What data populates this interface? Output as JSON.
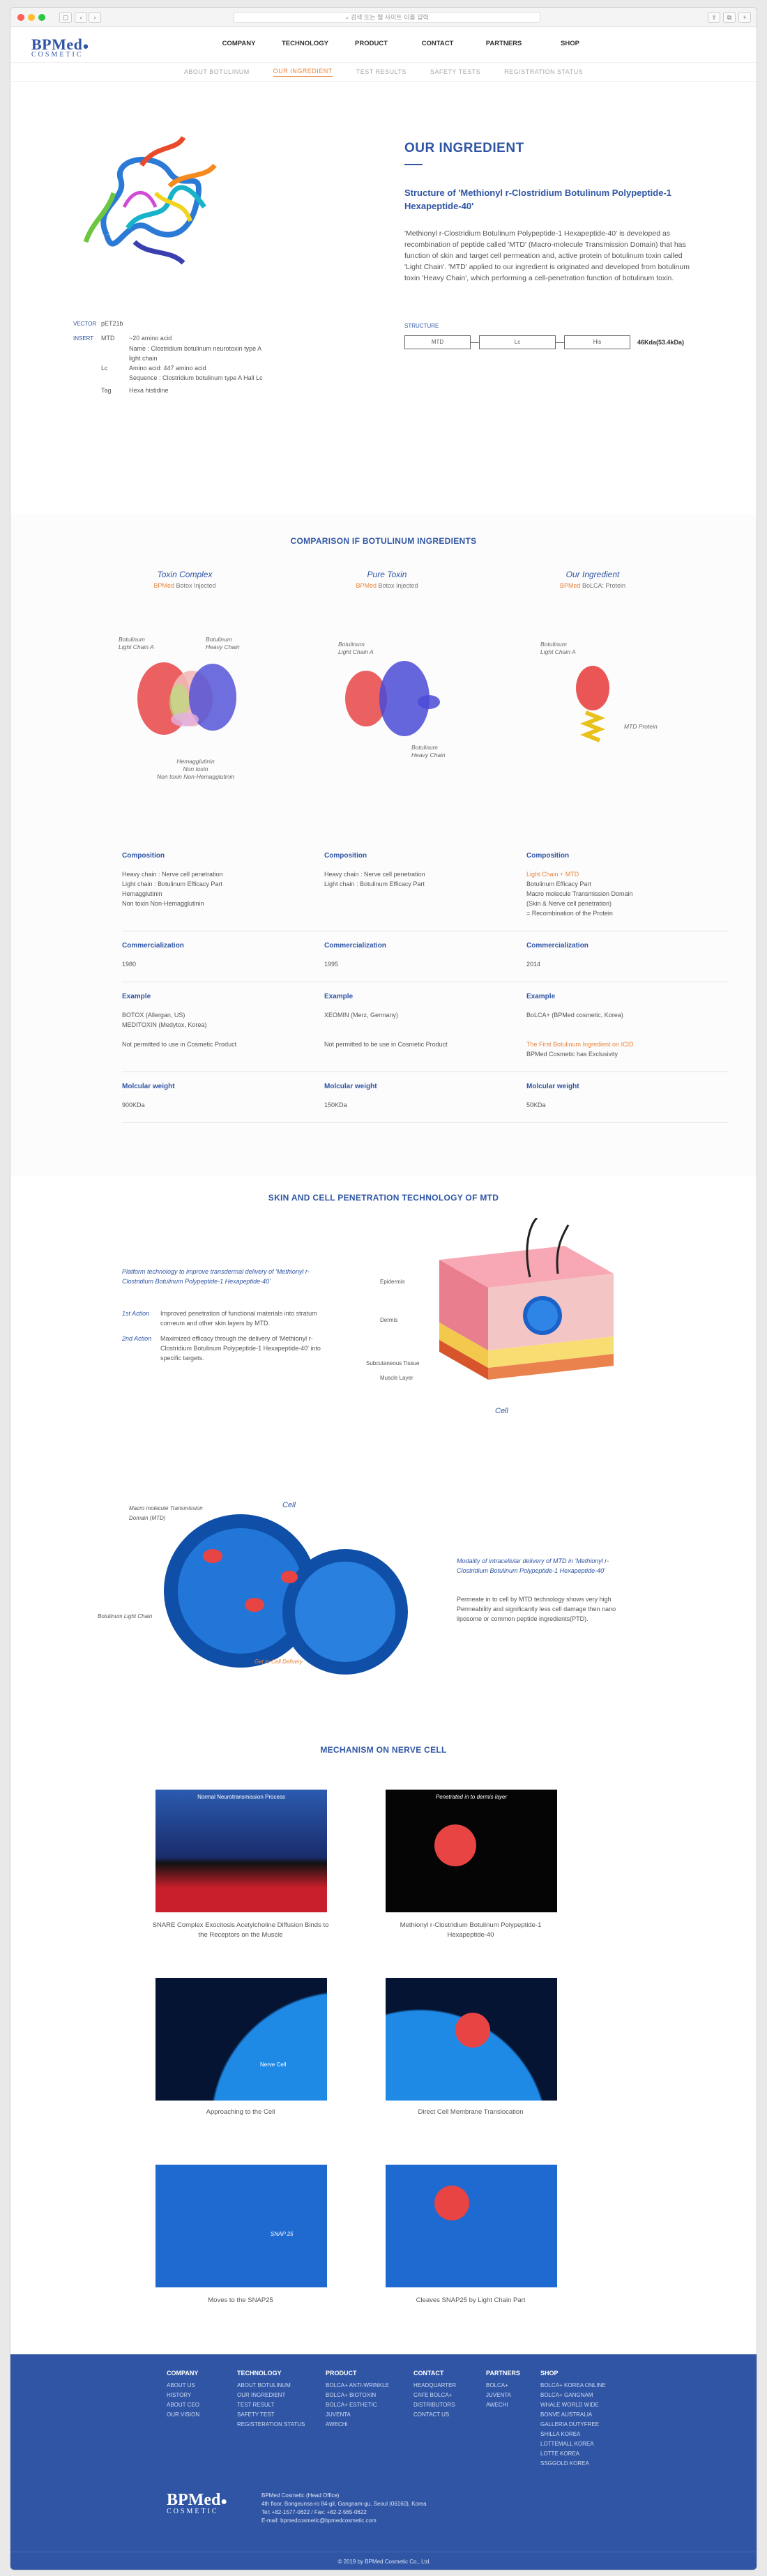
{
  "browser": {
    "url": "검색 또는 웹 사이트 이름 입력"
  },
  "logo": {
    "name": "BPMed",
    "sub": "COSMETIC"
  },
  "nav": [
    "COMPANY",
    "TECHNOLOGY",
    "PRODUCT",
    "CONTACT",
    "PARTNERS",
    "SHOP"
  ],
  "subnav": [
    "ABOUT BOTULINUM",
    "OUR INGREDIENT",
    "TEST RESULTS",
    "SAFETY TESTS",
    "REGISTRATION STATUS"
  ],
  "ingredient": {
    "title": "OUR INGREDIENT",
    "subtitle": "Structure of 'Methionyl r-Clostridium Botulinum Polypeptide-1 Hexapeptide-40'",
    "description": "'Methionyl r-Clostridium Botulinum Polypeptide-1 Hexapeptide-40' is developed as recombination of peptide called 'MTD' (Macro-molecule Transmission Domain) that has function of skin and target cell permeation and, active protein of botulinum toxin called 'Light Chain'. 'MTD' applied to our ingredient is originated and developed from botulinum toxin 'Heavy Chain', which performing a cell-penetration function of botulinum toxin.",
    "specs": {
      "vector_label": "VECTOR",
      "vector_value": "pET21b",
      "insert_label": "INSERT",
      "mtd_key": "MTD",
      "mtd_1": "~20 amino acid",
      "mtd_2": "Name : Clostridium botulinum neurotoxin type A",
      "mtd_3": "light chain",
      "lc_key": "Lc",
      "lc_1": "Amino acid: 447 amino acid",
      "lc_2": "Sequence : Clostridium botulinum type A Hall Lc",
      "tag_key": "Tag",
      "tag_1": "Hexa histidine"
    },
    "structure_label": "STRUCTURE",
    "structure_boxes": [
      "MTD",
      "Lc",
      "His"
    ],
    "structure_weight": "46Kda(53.4kDa)"
  },
  "comparison": {
    "title": "COMPARISON IF BOTULINUM INGREDIENTS",
    "cols": [
      {
        "head": "Toxin Complex",
        "brand": "BPMed",
        "sub": "Botox Injected"
      },
      {
        "head": "Pure Toxin",
        "brand": "BPMed",
        "sub": "Botox Injected"
      },
      {
        "head": "Our Ingredient",
        "brand": "BPMed",
        "sub": "BoLCA: Protein"
      }
    ],
    "labels": {
      "a1": "Botulinum",
      "a2": "Light Chain A",
      "b1": "Botulinum",
      "b2": "Heavy Chain",
      "c1": "Hemagglutinin",
      "c2": "Non toxin",
      "c3": "Non toxin Non-Hemagglutinin",
      "d1": "Botulinum",
      "d2": "Light Chain A",
      "e1": "Botulinum",
      "e2": "Heavy Chain",
      "f1": "Botulinum",
      "f2": "Light Chain A",
      "g1": "MTD Protein"
    },
    "rows": [
      {
        "head": "Composition",
        "cells": [
          [
            "Heavy chain : Nerve cell penetration",
            "Light chain : Botulinum Efficacy Part",
            "Hemagglutinin",
            "Non toxin Non-Hemagglutinin"
          ],
          [
            "Heavy chain : Nerve cell penetration",
            "Light chain : Botulinum Efficacy Part"
          ],
          [
            "Light Chain + MTD",
            "Botulinum Efficacy Part",
            "Macro molecule Transmission Domain",
            "(Skin & Nerve cell penetration)",
            "= Recombination of the Protein"
          ]
        ]
      },
      {
        "head": "Commercialization",
        "cells": [
          [
            "1980"
          ],
          [
            "1995"
          ],
          [
            "2014"
          ]
        ]
      },
      {
        "head": "Example",
        "cells": [
          [
            "BOTOX (Allergan, US)",
            "MEDITOXIN (Medytox, Korea)",
            "",
            "Not permitted to use in Cosmetic Product"
          ],
          [
            "XEOMIN (Merz, Germany)",
            "",
            "",
            "Not permitted to be use in Cosmetic Product"
          ],
          [
            "BoLCA+ (BPMed cosmetic, Korea)",
            "",
            "",
            "The First Botulinum Ingredient on ICID",
            "BPMed Cosmetic has Exclusivity"
          ]
        ]
      },
      {
        "head": "Molcular weight",
        "cells": [
          [
            "900KDa"
          ],
          [
            "150KDa"
          ],
          [
            "50KDa"
          ]
        ]
      }
    ]
  },
  "skin": {
    "title": "SKIN AND CELL PENETRATION TECHNOLOGY OF MTD",
    "lead": "Platform technology to improve transdermal delivery of 'Methionyl r-Clostridium Botulinum Polypeptide-1 Hexapeptide-40'",
    "a1_key": "1st Action",
    "a1_text": "Improved penetration of functional materials into stratum corneum and other skin layers by MTD.",
    "a2_key": "2nd Action",
    "a2_text": "Maximized efficacy through the delivery of 'Methionyl r-Clostridium Botulinum Polypeptide-1 Hexapeptide-40' into specific targets.",
    "layers": [
      "Epidermis",
      "Dermis",
      "Subcutaneous Tissue",
      "Muscle Layer"
    ],
    "cell_label": "Cell",
    "cell_label2": "Cell",
    "mtd_label": "Macro molecule Transmission Domain (MTD)",
    "lc_label": "Botulinum Light Chain",
    "delivery_label": "Get to Cell Delivery",
    "modality": "Modality of intracellular delivery of MTD in 'Methionyl r-Clostridium Botulinum Polypeptide-1 Hexapeptide-40'",
    "permeate": "Permeate in to cell by MTD technology shows very high Permeability and significantly less cell damage then nano liposome or common peptide ingredients(PTD)."
  },
  "mechanism": {
    "title": "MECHANISM ON NERVE CELL",
    "items": [
      {
        "overlay": "Normal Neurotransmission Process",
        "caption": "SNARE Complex Exocitosis Acetylcholine Diffusion Binds to the Receptors on the Muscle"
      },
      {
        "overlay": "Penetrated in to dermis layer",
        "caption": "Methionyl r-Clostridium Botulinum Polypeptide-1 Hexapeptide-40"
      },
      {
        "overlay": "Nerve Cell",
        "caption": "Approaching to the Cell"
      },
      {
        "overlay": "",
        "caption": "Direct Cell Membrane Translocation"
      },
      {
        "overlay": "SNAP 25",
        "caption": "Moves to the SNAP25"
      },
      {
        "overlay": "",
        "caption": "Cleaves SNAP25 by Light Chain Part"
      }
    ]
  },
  "footer": {
    "cols": [
      {
        "head": "COMPANY",
        "items": [
          "ABOUT US",
          "HISTORY",
          "ABOUT CEO",
          "OUR VISION"
        ]
      },
      {
        "head": "TECHNOLOGY",
        "items": [
          "ABOUT BOTULINUM",
          "OUR INGREDIENT",
          "TEST RESULT",
          "SAFETY TEST",
          "REGISTERATION STATUS"
        ]
      },
      {
        "head": "PRODUCT",
        "items": [
          "BOLCA+ ANTI-WRINKLE",
          "BOLCA+ BIOTOXIN",
          "BOLCA+ ESTHETIC",
          "JUVENTA",
          "AWECHI"
        ]
      },
      {
        "head": "CONTACT",
        "items": [
          "HEADQUARTER",
          "CAFE BOLCA+",
          "DISTRIBUTORS",
          "CONTACT US"
        ]
      },
      {
        "head": "PARTNERS",
        "items": [
          "BOLCA+",
          "JUVENTA",
          "AWECHI"
        ]
      },
      {
        "head": "SHOP",
        "items": [
          "BOLCA+ KOREA ONLINE",
          "BOLCA+ GANGNAM",
          "WHALE WORLD WIDE",
          "BONVE AUSTRALIA",
          "GALLERIA DUTYFREE",
          "SHILLA KOREA",
          "LOTTEMALL KOREA",
          "LOTTE KOREA",
          "SSGGOLD KOREA"
        ]
      }
    ],
    "logo": "BPMed",
    "logo_sub": "COSMETIC",
    "addr": [
      "BPMed Cosmetic (Head Office)",
      "4th floor, Bongeunsa-ro 84-gil, Gangnam-gu, Seoul (06160), Korea",
      "Tel: +82-1577-0622 / Fax: +82-2-565-0622",
      "E-mail: bpmedcosmetic@bpmedcosmetic.com"
    ],
    "copyright": "© 2019 by BPMed Cosmetic Co., Ltd."
  }
}
